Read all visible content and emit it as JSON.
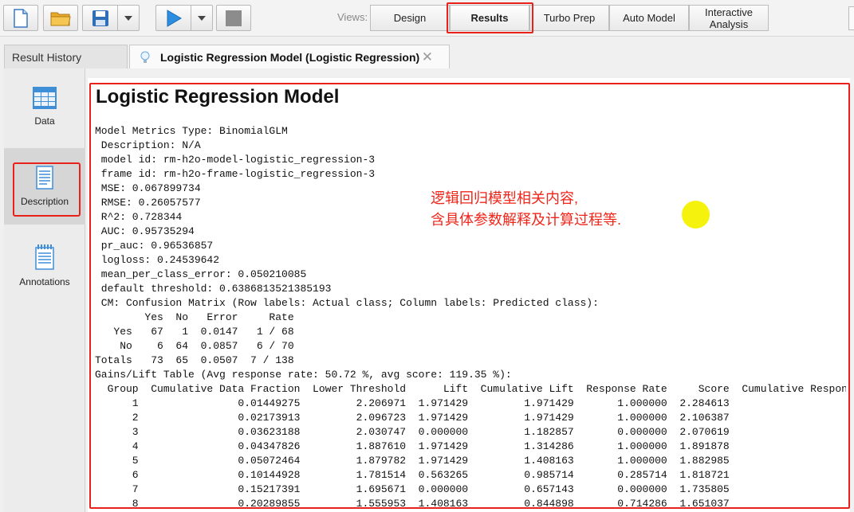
{
  "toolbar": {
    "views_label": "Views:",
    "views": [
      "Design",
      "Results",
      "Turbo Prep",
      "Auto Model",
      "Interactive Analysis"
    ],
    "active_view": "Results"
  },
  "tabs": {
    "result_history": "Result History",
    "active_tab": "Logistic Regression Model (Logistic Regression)",
    "close_symbol": "✕"
  },
  "side_panel": {
    "items": [
      {
        "label": "Data",
        "icon": "table-icon"
      },
      {
        "label": "Description",
        "icon": "document-icon"
      },
      {
        "label": "Annotations",
        "icon": "notepad-icon"
      }
    ],
    "selected": "Description"
  },
  "report": {
    "title": "Logistic Regression Model",
    "lines": [
      "Model Metrics Type: BinomialGLM",
      " Description: N/A",
      " model id: rm-h2o-model-logistic_regression-3",
      " frame id: rm-h2o-frame-logistic_regression-3",
      " MSE: 0.067899734",
      " RMSE: 0.26057577",
      " R^2: 0.728344",
      " AUC: 0.95735294",
      " pr_auc: 0.96536857",
      " logloss: 0.24539642",
      " mean_per_class_error: 0.050210085",
      " default threshold: 0.6386813521385193",
      " CM: Confusion Matrix (Row labels: Actual class; Column labels: Predicted class):",
      "        Yes  No   Error     Rate",
      "   Yes   67   1  0.0147   1 / 68",
      "    No    6  64  0.0857   6 / 70",
      "Totals   73  65  0.0507  7 / 138",
      "Gains/Lift Table (Avg response rate: 50.72 %, avg score: 119.35 %):",
      "  Group  Cumulative Data Fraction  Lower Threshold      Lift  Cumulative Lift  Response Rate     Score  Cumulative Response Rate",
      "      1                0.01449275         2.206971  1.971429         1.971429       1.000000  2.284613",
      "      2                0.02173913         2.096723  1.971429         1.971429       1.000000  2.106387",
      "      3                0.03623188         2.030747  0.000000         1.182857       0.000000  2.070619",
      "      4                0.04347826         1.887610  1.971429         1.314286       1.000000  1.891878",
      "      5                0.05072464         1.879782  1.971429         1.408163       1.000000  1.882985",
      "      6                0.10144928         1.781514  0.563265         0.985714       0.285714  1.818721",
      "      7                0.15217391         1.695671  0.000000         0.657143       0.000000  1.735805",
      "      8                0.20289855         1.555953  1.408163         0.844898       0.714286  1.651037"
    ]
  },
  "annotation": {
    "line1": "逻辑回归模型相关内容,",
    "line2": "含具体参数解释及计算过程等."
  },
  "colors": {
    "highlight": "#e8221a",
    "annotation_text": "#f0251a",
    "marker_dot": "#f5f20e"
  }
}
